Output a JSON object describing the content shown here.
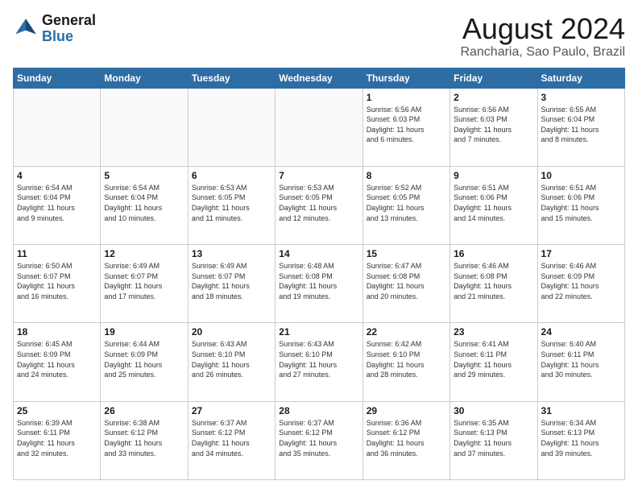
{
  "logo": {
    "line1": "General",
    "line2": "Blue"
  },
  "title": "August 2024",
  "location": "Rancharia, Sao Paulo, Brazil",
  "days_header": [
    "Sunday",
    "Monday",
    "Tuesday",
    "Wednesday",
    "Thursday",
    "Friday",
    "Saturday"
  ],
  "weeks": [
    [
      {
        "day": "",
        "info": ""
      },
      {
        "day": "",
        "info": ""
      },
      {
        "day": "",
        "info": ""
      },
      {
        "day": "",
        "info": ""
      },
      {
        "day": "1",
        "info": "Sunrise: 6:56 AM\nSunset: 6:03 PM\nDaylight: 11 hours\nand 6 minutes."
      },
      {
        "day": "2",
        "info": "Sunrise: 6:56 AM\nSunset: 6:03 PM\nDaylight: 11 hours\nand 7 minutes."
      },
      {
        "day": "3",
        "info": "Sunrise: 6:55 AM\nSunset: 6:04 PM\nDaylight: 11 hours\nand 8 minutes."
      }
    ],
    [
      {
        "day": "4",
        "info": "Sunrise: 6:54 AM\nSunset: 6:04 PM\nDaylight: 11 hours\nand 9 minutes."
      },
      {
        "day": "5",
        "info": "Sunrise: 6:54 AM\nSunset: 6:04 PM\nDaylight: 11 hours\nand 10 minutes."
      },
      {
        "day": "6",
        "info": "Sunrise: 6:53 AM\nSunset: 6:05 PM\nDaylight: 11 hours\nand 11 minutes."
      },
      {
        "day": "7",
        "info": "Sunrise: 6:53 AM\nSunset: 6:05 PM\nDaylight: 11 hours\nand 12 minutes."
      },
      {
        "day": "8",
        "info": "Sunrise: 6:52 AM\nSunset: 6:05 PM\nDaylight: 11 hours\nand 13 minutes."
      },
      {
        "day": "9",
        "info": "Sunrise: 6:51 AM\nSunset: 6:06 PM\nDaylight: 11 hours\nand 14 minutes."
      },
      {
        "day": "10",
        "info": "Sunrise: 6:51 AM\nSunset: 6:06 PM\nDaylight: 11 hours\nand 15 minutes."
      }
    ],
    [
      {
        "day": "11",
        "info": "Sunrise: 6:50 AM\nSunset: 6:07 PM\nDaylight: 11 hours\nand 16 minutes."
      },
      {
        "day": "12",
        "info": "Sunrise: 6:49 AM\nSunset: 6:07 PM\nDaylight: 11 hours\nand 17 minutes."
      },
      {
        "day": "13",
        "info": "Sunrise: 6:49 AM\nSunset: 6:07 PM\nDaylight: 11 hours\nand 18 minutes."
      },
      {
        "day": "14",
        "info": "Sunrise: 6:48 AM\nSunset: 6:08 PM\nDaylight: 11 hours\nand 19 minutes."
      },
      {
        "day": "15",
        "info": "Sunrise: 6:47 AM\nSunset: 6:08 PM\nDaylight: 11 hours\nand 20 minutes."
      },
      {
        "day": "16",
        "info": "Sunrise: 6:46 AM\nSunset: 6:08 PM\nDaylight: 11 hours\nand 21 minutes."
      },
      {
        "day": "17",
        "info": "Sunrise: 6:46 AM\nSunset: 6:09 PM\nDaylight: 11 hours\nand 22 minutes."
      }
    ],
    [
      {
        "day": "18",
        "info": "Sunrise: 6:45 AM\nSunset: 6:09 PM\nDaylight: 11 hours\nand 24 minutes."
      },
      {
        "day": "19",
        "info": "Sunrise: 6:44 AM\nSunset: 6:09 PM\nDaylight: 11 hours\nand 25 minutes."
      },
      {
        "day": "20",
        "info": "Sunrise: 6:43 AM\nSunset: 6:10 PM\nDaylight: 11 hours\nand 26 minutes."
      },
      {
        "day": "21",
        "info": "Sunrise: 6:43 AM\nSunset: 6:10 PM\nDaylight: 11 hours\nand 27 minutes."
      },
      {
        "day": "22",
        "info": "Sunrise: 6:42 AM\nSunset: 6:10 PM\nDaylight: 11 hours\nand 28 minutes."
      },
      {
        "day": "23",
        "info": "Sunrise: 6:41 AM\nSunset: 6:11 PM\nDaylight: 11 hours\nand 29 minutes."
      },
      {
        "day": "24",
        "info": "Sunrise: 6:40 AM\nSunset: 6:11 PM\nDaylight: 11 hours\nand 30 minutes."
      }
    ],
    [
      {
        "day": "25",
        "info": "Sunrise: 6:39 AM\nSunset: 6:11 PM\nDaylight: 11 hours\nand 32 minutes."
      },
      {
        "day": "26",
        "info": "Sunrise: 6:38 AM\nSunset: 6:12 PM\nDaylight: 11 hours\nand 33 minutes."
      },
      {
        "day": "27",
        "info": "Sunrise: 6:37 AM\nSunset: 6:12 PM\nDaylight: 11 hours\nand 34 minutes."
      },
      {
        "day": "28",
        "info": "Sunrise: 6:37 AM\nSunset: 6:12 PM\nDaylight: 11 hours\nand 35 minutes."
      },
      {
        "day": "29",
        "info": "Sunrise: 6:36 AM\nSunset: 6:12 PM\nDaylight: 11 hours\nand 36 minutes."
      },
      {
        "day": "30",
        "info": "Sunrise: 6:35 AM\nSunset: 6:13 PM\nDaylight: 11 hours\nand 37 minutes."
      },
      {
        "day": "31",
        "info": "Sunrise: 6:34 AM\nSunset: 6:13 PM\nDaylight: 11 hours\nand 39 minutes."
      }
    ]
  ]
}
